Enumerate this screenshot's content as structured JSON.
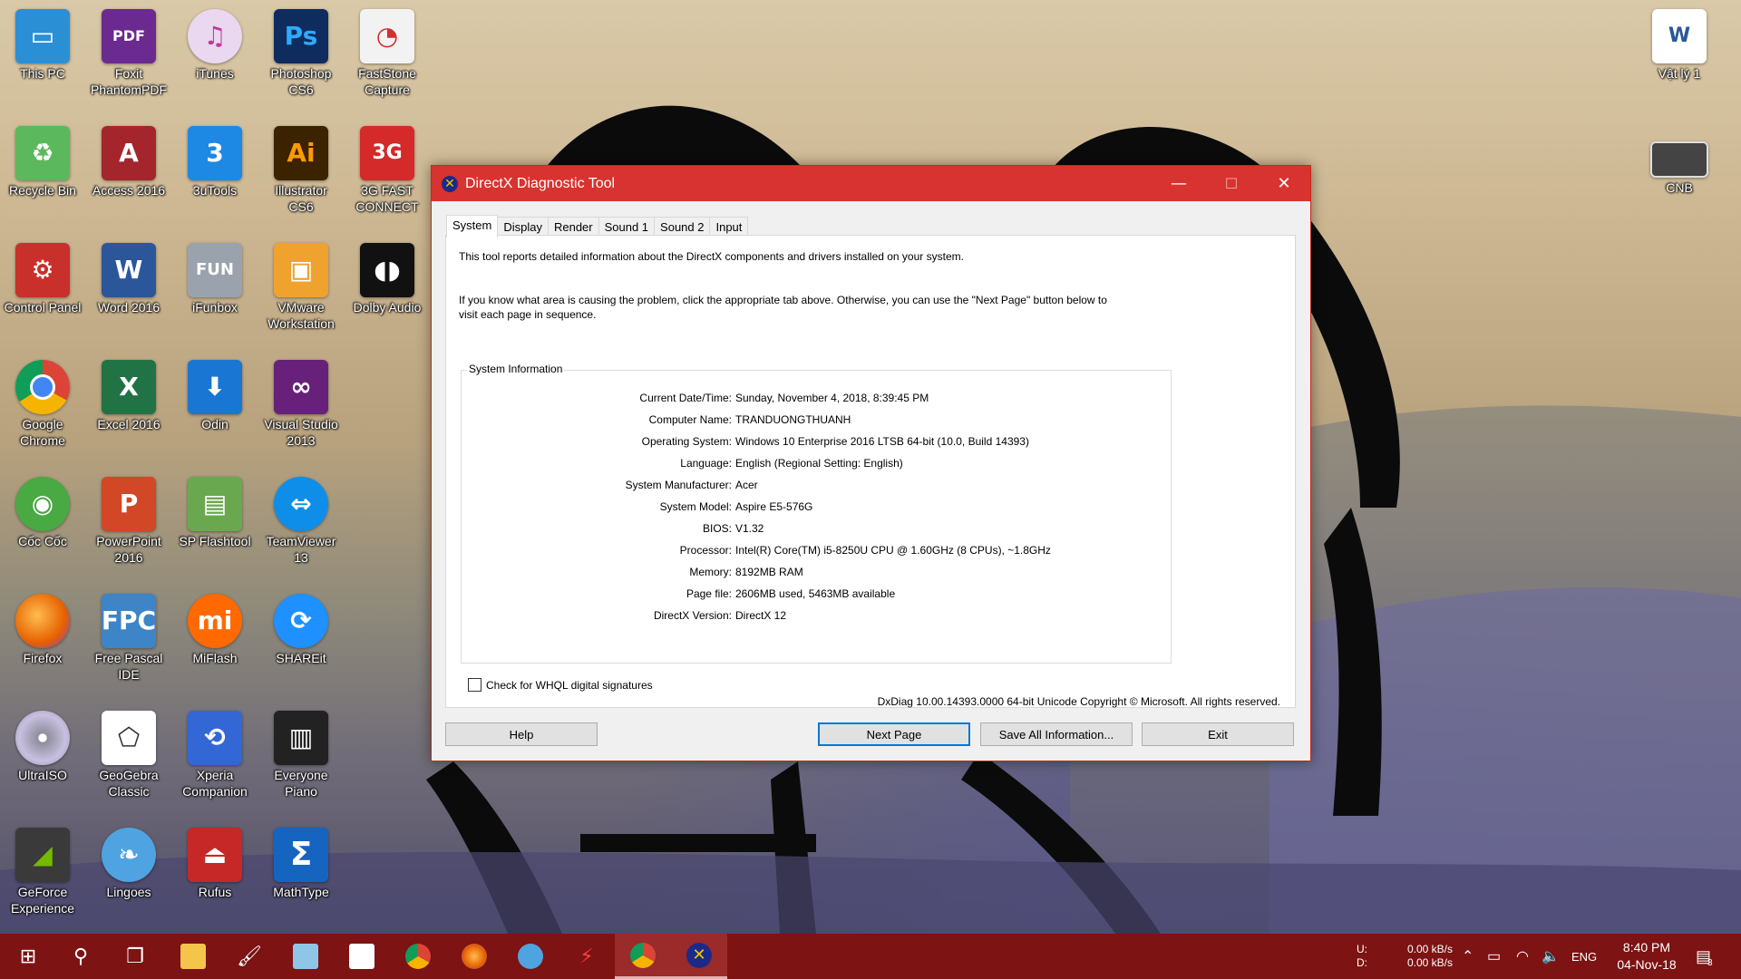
{
  "desktop_icons": [
    {
      "label": "This PC",
      "icon": "computer-icon",
      "color": "#2b8fd6"
    },
    {
      "label": "Foxit PhantomPDF",
      "icon": "pdf-icon",
      "color": "#6b2a8f"
    },
    {
      "label": "iTunes",
      "icon": "music-note-icon",
      "color": "#e9d8f0"
    },
    {
      "label": "Photoshop CS6",
      "icon": "photoshop-icon",
      "color": "#0e2d5e"
    },
    {
      "label": "FastStone Capture",
      "icon": "capture-icon",
      "color": "#f2f2f2"
    },
    {
      "label": "Recycle Bin",
      "icon": "recycle-bin-icon",
      "color": "#5cb85c"
    },
    {
      "label": "Access 2016",
      "icon": "access-icon",
      "color": "#a4262c"
    },
    {
      "label": "3uTools",
      "icon": "3utools-icon",
      "color": "#1e88e5"
    },
    {
      "label": "Illustrator CS6",
      "icon": "illustrator-icon",
      "color": "#3b2300"
    },
    {
      "label": "3G FAST CONNECT",
      "icon": "3g-icon",
      "color": "#d42a2a"
    },
    {
      "label": "Control Panel",
      "icon": "control-panel-icon",
      "color": "#c9302c"
    },
    {
      "label": "Word 2016",
      "icon": "word-icon",
      "color": "#2b579a"
    },
    {
      "label": "iFunbox",
      "icon": "ifunbox-icon",
      "color": "#9aa3ad"
    },
    {
      "label": "VMware Workstation",
      "icon": "vmware-icon",
      "color": "#f0a22e"
    },
    {
      "label": "Dolby Audio",
      "icon": "dolby-icon",
      "color": "#111111"
    },
    {
      "label": "Google Chrome",
      "icon": "chrome-icon",
      "color": "#4285f4"
    },
    {
      "label": "Excel 2016",
      "icon": "excel-icon",
      "color": "#217346"
    },
    {
      "label": "Odin",
      "icon": "odin-icon",
      "color": "#1976d2"
    },
    {
      "label": "Visual Studio 2013",
      "icon": "visual-studio-icon",
      "color": "#68217a"
    },
    {
      "label": "Cốc Cốc",
      "icon": "coccoc-icon",
      "color": "#49a942"
    },
    {
      "label": "PowerPoint 2016",
      "icon": "powerpoint-icon",
      "color": "#d24726"
    },
    {
      "label": "SP Flashtool",
      "icon": "flashtool-icon",
      "color": "#6aa84f"
    },
    {
      "label": "TeamViewer 13",
      "icon": "teamviewer-icon",
      "color": "#0e8ee9"
    },
    {
      "label": "Firefox",
      "icon": "firefox-icon",
      "color": "#e66000"
    },
    {
      "label": "Free Pascal IDE",
      "icon": "pascal-icon",
      "color": "#3d85c6"
    },
    {
      "label": "MiFlash",
      "icon": "miflash-icon",
      "color": "#ff6900"
    },
    {
      "label": "SHAREit",
      "icon": "shareit-icon",
      "color": "#1e90ff"
    },
    {
      "label": "UltraISO",
      "icon": "disc-icon",
      "color": "#8e8e9e"
    },
    {
      "label": "GeoGebra Classic",
      "icon": "geogebra-icon",
      "color": "#ffffff"
    },
    {
      "label": "Xperia Companion",
      "icon": "xperia-icon",
      "color": "#3367d6"
    },
    {
      "label": "Everyone Piano",
      "icon": "piano-icon",
      "color": "#222222"
    },
    {
      "label": "GeForce Experience",
      "icon": "geforce-icon",
      "color": "#3a3a3a"
    },
    {
      "label": "Lingoes",
      "icon": "lingoes-icon",
      "color": "#4fa3e0"
    },
    {
      "label": "Rufus",
      "icon": "usb-icon",
      "color": "#c62828"
    },
    {
      "label": "MathType",
      "icon": "sigma-icon",
      "color": "#1565c0"
    },
    {
      "label": "Vật lý 1",
      "icon": "word-document-icon",
      "color": "#ffffff"
    },
    {
      "label": "CNB",
      "icon": "window-thumbnail-icon",
      "color": "#dddddd"
    }
  ],
  "dialog": {
    "title": "DirectX Diagnostic Tool",
    "tabs": [
      "System",
      "Display",
      "Render",
      "Sound 1",
      "Sound 2",
      "Input"
    ],
    "active_tab": "System",
    "intro_1": "This tool reports detailed information about the DirectX components and drivers installed on your system.",
    "intro_2a": "If you know what area is causing the problem, click the appropriate tab above.  Otherwise, you can use the \"Next Page\" button below to",
    "intro_2b": "visit each page in sequence.",
    "group_title": "System Information",
    "info": [
      {
        "key": "Current Date/Time:",
        "value": "Sunday, November 4, 2018, 8:39:45 PM"
      },
      {
        "key": "Computer Name:",
        "value": "TRANDUONGTHUANH"
      },
      {
        "key": "Operating System:",
        "value": "Windows 10 Enterprise 2016 LTSB 64-bit (10.0, Build 14393)"
      },
      {
        "key": "Language:",
        "value": "English (Regional Setting: English)"
      },
      {
        "key": "System Manufacturer:",
        "value": "Acer"
      },
      {
        "key": "System Model:",
        "value": "Aspire E5-576G"
      },
      {
        "key": "BIOS:",
        "value": "V1.32"
      },
      {
        "key": "Processor:",
        "value": "Intel(R) Core(TM) i5-8250U CPU @ 1.60GHz (8 CPUs), ~1.8GHz"
      },
      {
        "key": "Memory:",
        "value": "8192MB RAM"
      },
      {
        "key": "Page file:",
        "value": "2606MB used, 5463MB available"
      },
      {
        "key": "DirectX Version:",
        "value": "DirectX 12"
      }
    ],
    "whql_label": "Check for WHQL digital signatures",
    "footer": "DxDiag 10.00.14393.0000 64-bit Unicode  Copyright © Microsoft. All rights reserved.",
    "buttons": {
      "help": "Help",
      "next": "Next Page",
      "save": "Save All Information...",
      "exit": "Exit"
    },
    "window_buttons": {
      "minimize": "—",
      "maximize": "☐",
      "close": "✕"
    }
  },
  "taskbar": {
    "color": "#7d1313",
    "apps": [
      "windows-start-icon",
      "search-icon",
      "task-view-icon",
      "file-explorer-icon",
      "paint-icon",
      "notepad-icon",
      "calendar-icon",
      "chrome-icon",
      "firefox-icon",
      "lingoes-icon",
      "flash-icon",
      "chrome-icon",
      "directx-icon"
    ],
    "net_u_label": "U:",
    "net_d_label": "D:",
    "net_up": "0.00 kB/s",
    "net_down": "0.00 kB/s",
    "language": "ENG",
    "time": "8:40 PM",
    "date": "04-Nov-18",
    "notification_count": "3"
  }
}
